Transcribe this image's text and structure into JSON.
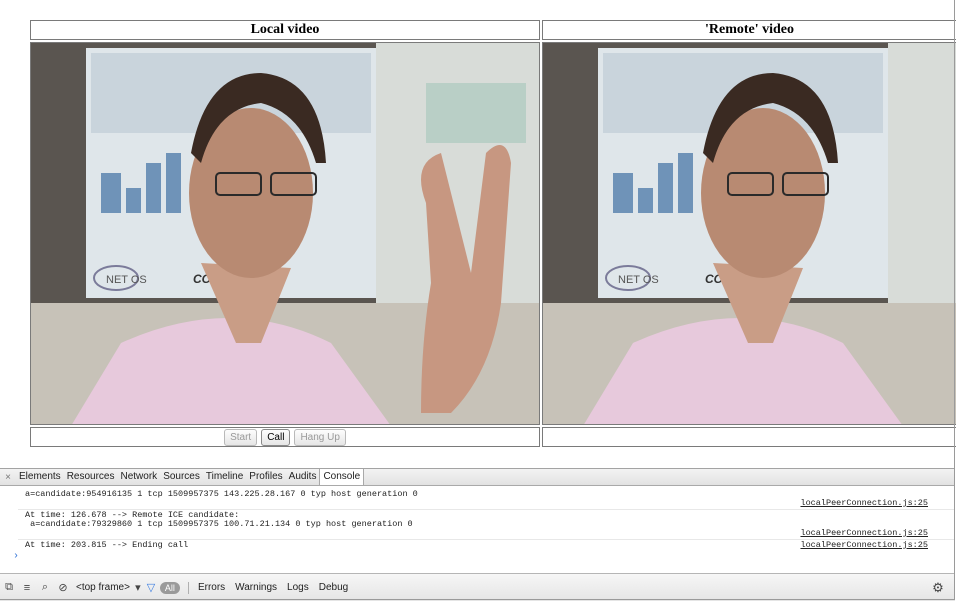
{
  "local": {
    "title": "Local video"
  },
  "remote": {
    "title": "'Remote' video"
  },
  "controls": {
    "start": "Start",
    "call": "Call",
    "hangup": "Hang Up"
  },
  "devtools": {
    "tabs": [
      "Elements",
      "Resources",
      "Network",
      "Sources",
      "Timeline",
      "Profiles",
      "Audits",
      "Console"
    ],
    "selected_tab": "Console",
    "close_glyph": "×",
    "log": [
      {
        "text": "a=candidate:954916135 1 tcp 1509957375 143.225.28.167 0 typ host generation 0",
        "source": "localPeerConnection.js:25"
      },
      {
        "text": "At time: 126.678 --> Remote ICE candidate:\n a=candidate:79329860 1 tcp 1509957375 100.71.21.134 0 typ host generation 0",
        "source": "localPeerConnection.js:25"
      },
      {
        "text": "At time: 203.815 --> Ending call",
        "source": "localPeerConnection.js:25"
      }
    ],
    "prompt_glyph": "›",
    "frame_select": "<top frame>",
    "filter_all": "All",
    "levels": [
      "Errors",
      "Warnings",
      "Logs",
      "Debug"
    ]
  },
  "poster": {
    "logo_left": "NET OS",
    "logo_right": "CONTENT"
  }
}
